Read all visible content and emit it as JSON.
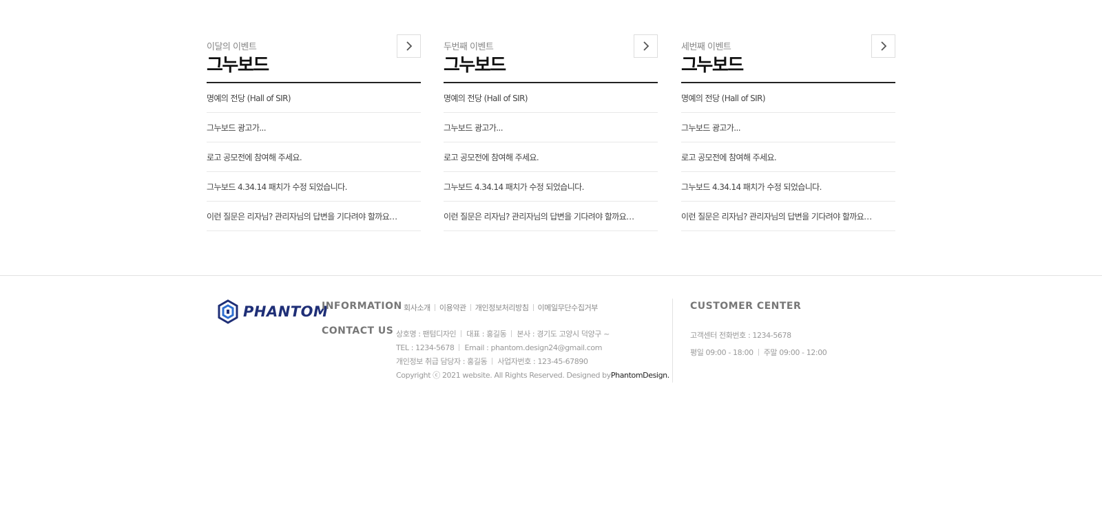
{
  "boards": [
    {
      "subtitle": "이달의 이벤트",
      "title": "그누보드",
      "items": [
        "명예의 전당 (Hall of SIR)",
        "그누보드 광고가...",
        "로고 공모전에 참여해 주세요.",
        "그누보드 4.34.14 패치가 수정 되었습니다.",
        "이런 질문은 리자님? 관리자님의 답변을 기다려야 할까요…"
      ]
    },
    {
      "subtitle": "두번째 이벤트",
      "title": "그누보드",
      "items": [
        "명예의 전당 (Hall of SIR)",
        "그누보드 광고가...",
        "로고 공모전에 참여해 주세요.",
        "그누보드 4.34.14 패치가 수정 되었습니다.",
        "이런 질문은 리자님? 관리자님의 답변을 기다려야 할까요…"
      ]
    },
    {
      "subtitle": "세번째 이벤트",
      "title": "그누보드",
      "items": [
        "명예의 전당 (Hall of SIR)",
        "그누보드 광고가...",
        "로고 공모전에 참여해 주세요.",
        "그누보드 4.34.14 패치가 수정 되었습니다.",
        "이런 질문은 리자님? 관리자님의 답변을 기다려야 할까요…"
      ]
    }
  ],
  "footer": {
    "logo_text": "PHANTOM",
    "information_label": "INFORMATION",
    "info_links": [
      "회사소개",
      "이용약관",
      "개인정보처리방침",
      "이메일무단수집거부"
    ],
    "contact_label": "CONTACT US",
    "company": "상호명 : 팬텀디자인",
    "ceo": "대표 : 홍길동",
    "address": "본사 : 경기도 고양시 덕양구 ~",
    "tel": "TEL : 1234-5678",
    "email": "Email : phantom.design24@gmail.com",
    "privacy_officer": "개인정보 취급 담당자 : 홍길동",
    "business_number": "사업자번호 : 123-45-67890",
    "copyright": "Copyright ⓒ 2021 website. All Rights Reserved. Designed by ",
    "designer": "PhantomDesign.",
    "customer_center_label": "CUSTOMER CENTER",
    "cc_phone": "고객센터 전화번호 : 1234-5678",
    "cc_weekday": "평일 09:00 - 18:00",
    "cc_weekend": "주말 09:00 - 12:00"
  },
  "colors": {
    "logo": "#1f2f77",
    "title": "#111111",
    "text": "#444444",
    "muted": "#999999",
    "border": "#e8e8e8"
  }
}
